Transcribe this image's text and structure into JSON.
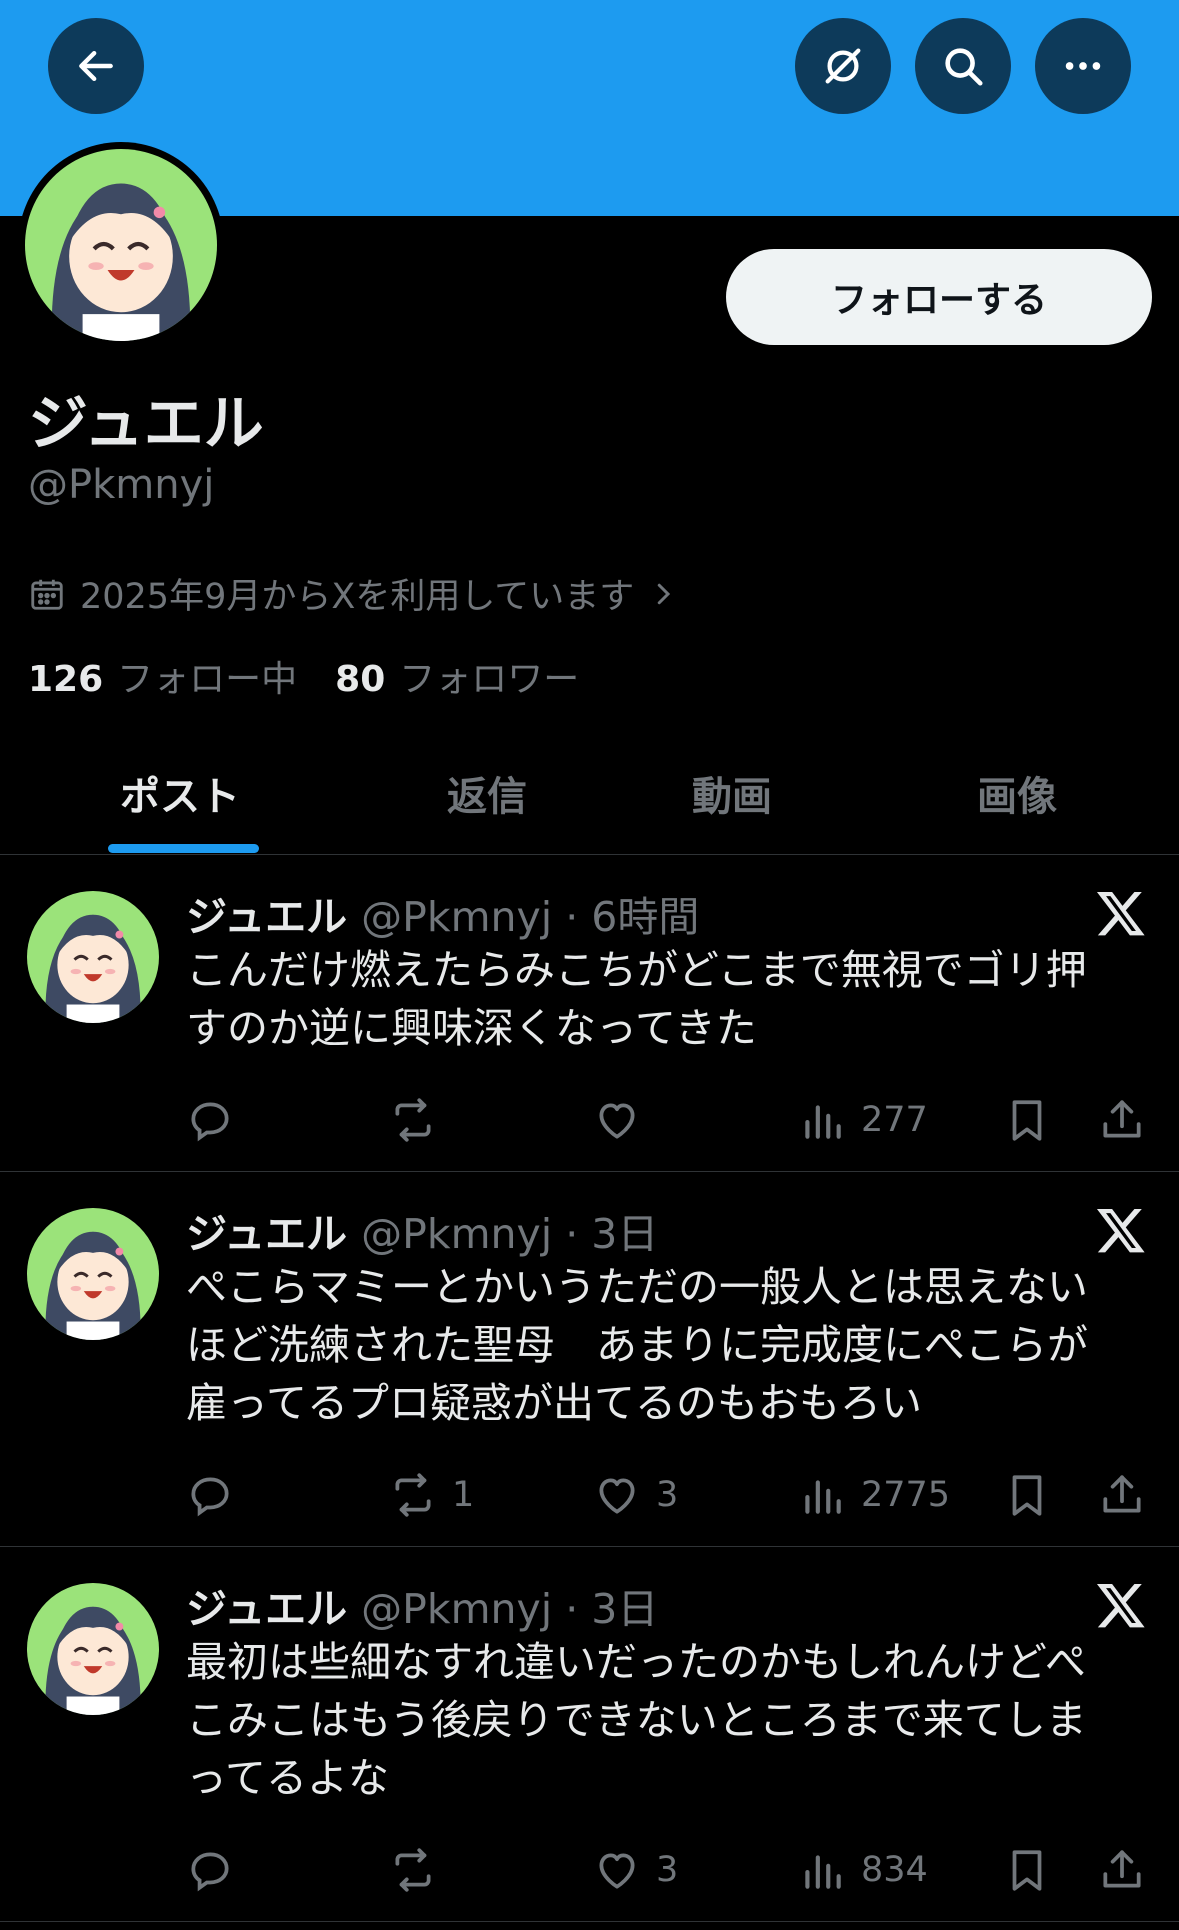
{
  "colors": {
    "banner": "#1d9bf0",
    "background": "#000000",
    "accent": "#1d9bf0",
    "muted": "#71767b",
    "text": "#e7e9ea"
  },
  "header": {
    "back_icon": "arrow-left-icon",
    "grok_icon": "slash-circle-icon",
    "search_icon": "search-icon",
    "more_icon": "more-horizontal-icon"
  },
  "profile": {
    "name": "ジュエル",
    "handle": "@Pkmnyj",
    "follow_label": "フォローする",
    "joined": "2025年9月からXを利用しています",
    "following_count": "126",
    "following_label": "フォロー中",
    "followers_count": "80",
    "followers_label": "フォロワー"
  },
  "tabs": [
    {
      "label": "ポスト",
      "active": true
    },
    {
      "label": "返信",
      "active": false
    },
    {
      "label": "動画",
      "active": false
    },
    {
      "label": "画像",
      "active": false
    }
  ],
  "posts": [
    {
      "name": "ジュエル",
      "meta": "@Pkmnyj · 6時間",
      "text": "こんだけ燃えたらみこちがどこまで無視でゴリ押すのか逆に興味深くなってきた",
      "retweets": "",
      "likes": "",
      "views": "277"
    },
    {
      "name": "ジュエル",
      "meta": "@Pkmnyj · 3日",
      "text": "ぺこらマミーとかいうただの一般人とは思えないほど洗練された聖母　あまりに完成度にぺこらが雇ってるプロ疑惑が出てるのもおもろい",
      "retweets": "1",
      "likes": "3",
      "views": "2775"
    },
    {
      "name": "ジュエル",
      "meta": "@Pkmnyj · 3日",
      "text": "最初は些細なすれ違いだったのかもしれんけどぺこみこはもう後戻りできないところまで来てしまってるよな",
      "retweets": "",
      "likes": "3",
      "views": "834"
    }
  ]
}
